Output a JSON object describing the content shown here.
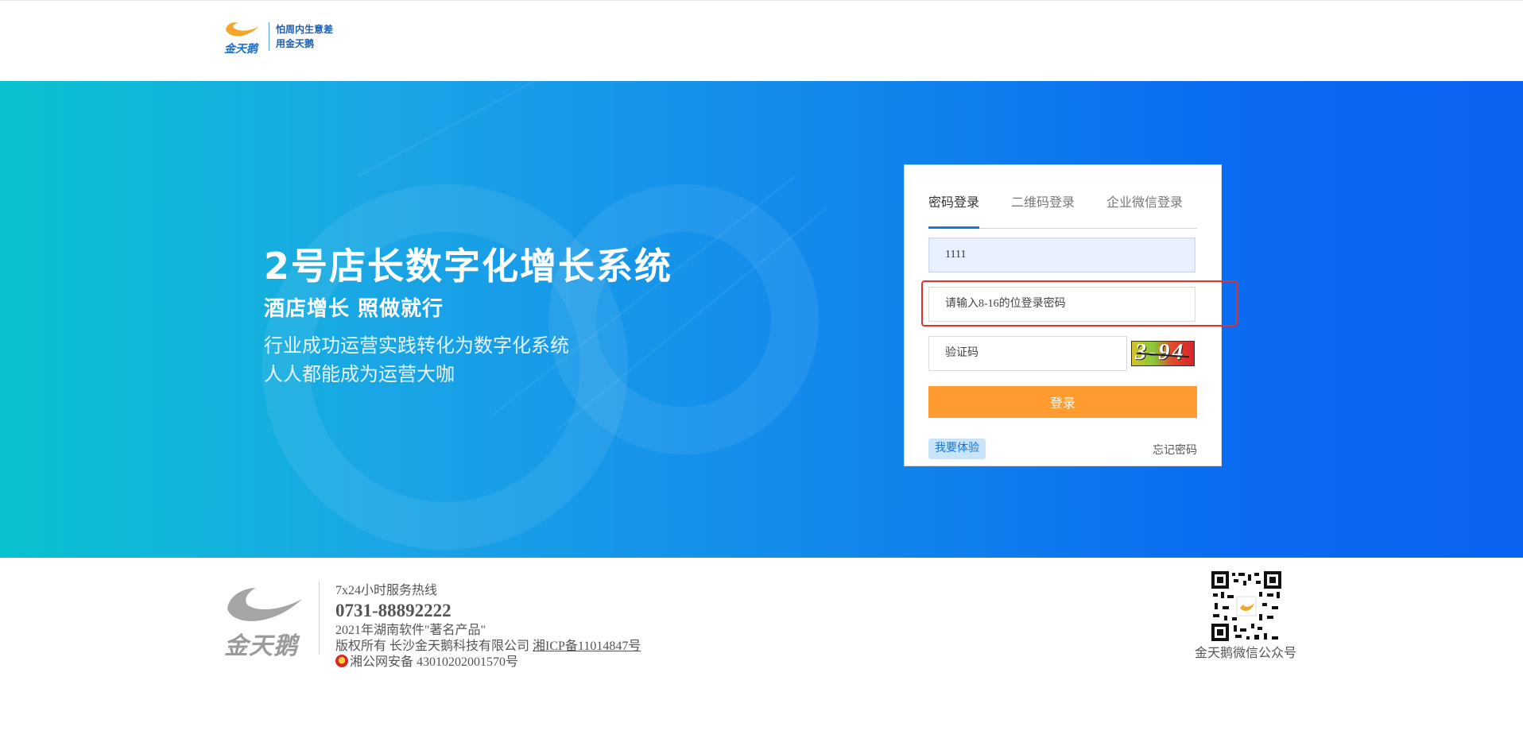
{
  "header": {
    "logo_text": "金天鹅",
    "slogan_line1": "怕周内生意差",
    "slogan_line2": "用金天鹅"
  },
  "hero": {
    "title": "2号店长数字化增长系统",
    "subtitle": "酒店增长 照做就行",
    "desc_line1": "行业成功运营实践转化为数字化系统",
    "desc_line2": "人人都能成为运营大咖"
  },
  "login": {
    "tabs": [
      "密码登录",
      "二维码登录",
      "企业微信登录"
    ],
    "username_value": "1111",
    "password_placeholder": "请输入8-16的位登录密码",
    "code_placeholder": "验证码",
    "captcha_text": "3-94",
    "login_label": "登录",
    "try_label": "我要体验",
    "forgot_label": "忘记密码"
  },
  "footer": {
    "logo_text": "金天鹅",
    "hotline_label": "7x24小时服务热线",
    "phone": "0731-88892222",
    "award": "2021年湖南软件\"著名产品\"",
    "copyright": "版权所有 长沙金天鹅科技有限公司",
    "icp": "湘ICP备11014847号",
    "police": "湘公网安备 43010202001570号",
    "qr_caption": "金天鹅微信公众号"
  },
  "colors": {
    "accent_blue": "#1a7ad8",
    "login_orange": "#ff9b2f",
    "highlight_red": "#e03131"
  }
}
